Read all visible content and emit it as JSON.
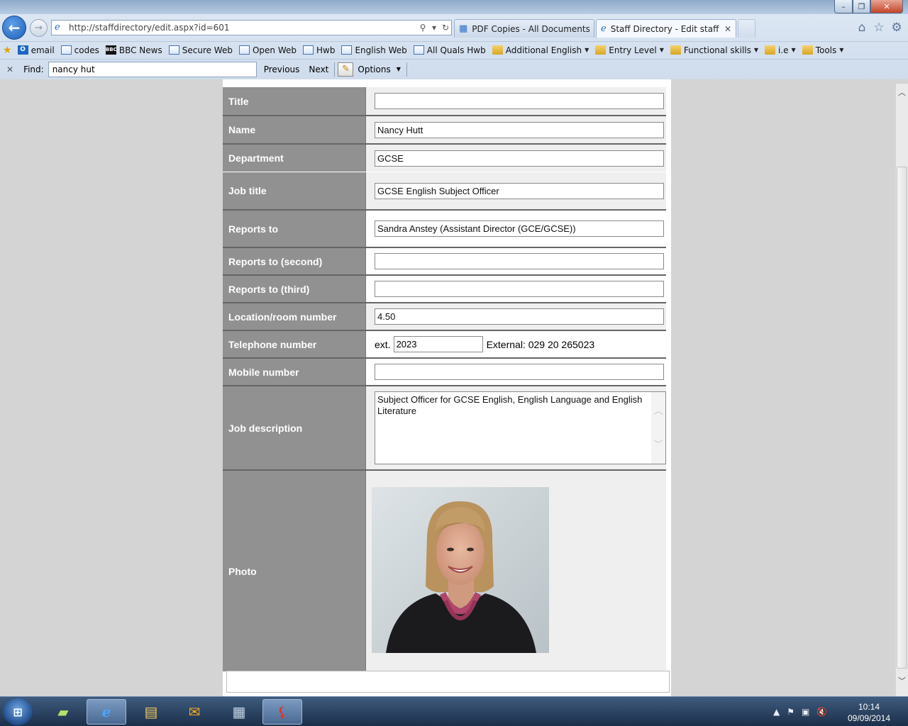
{
  "window": {
    "minimize_label": "–",
    "restore_label": "❐",
    "close_label": "✕"
  },
  "navigation": {
    "back_glyph": "←",
    "forward_glyph": "→",
    "address": "http://staffdirectory/edit.aspx?id=601"
  },
  "tabs": [
    {
      "label": "PDF Copies - All Documents",
      "icon": "sharepoint-page-icon"
    },
    {
      "label": "Staff Directory - Edit staff m...",
      "icon": "ie-page-icon",
      "close_label": "✕"
    }
  ],
  "favorites": {
    "items": [
      {
        "label": "email",
        "icon": "outlook-icon"
      },
      {
        "label": "codes",
        "icon": "web-page-icon"
      },
      {
        "label": "BBC News",
        "icon": "bbc-icon"
      },
      {
        "label": "Secure Web",
        "icon": "web-page-icon"
      },
      {
        "label": "Open Web",
        "icon": "web-page-icon"
      },
      {
        "label": "Hwb",
        "icon": "web-page-icon"
      },
      {
        "label": "English Web",
        "icon": "web-page-icon"
      },
      {
        "label": "All Quals Hwb",
        "icon": "web-page-icon"
      },
      {
        "label": "Additional English",
        "icon": "folder-icon"
      },
      {
        "label": "Entry Level",
        "icon": "folder-icon"
      },
      {
        "label": "Functional skills",
        "icon": "folder-icon"
      },
      {
        "label": "i.e",
        "icon": "folder-icon"
      },
      {
        "label": "Tools",
        "icon": "folder-icon"
      }
    ]
  },
  "find_bar": {
    "close_label": "✕",
    "label": "Find:",
    "value": "nancy hut",
    "previous_label": "Previous",
    "next_label": "Next",
    "options_label": "Options"
  },
  "form": {
    "title_label": "Title",
    "title_value": "",
    "name_label": "Name",
    "name_value": "Nancy Hutt",
    "department_label": "Department",
    "department_value": "GCSE",
    "job_title_label": "Job title",
    "job_title_value": "GCSE English Subject Officer",
    "reports_to_label": "Reports to",
    "reports_to_value": "Sandra Anstey (Assistant Director (GCE/GCSE))",
    "reports_to_second_label": "Reports to (second)",
    "reports_to_second_value": "",
    "reports_to_third_label": "Reports to (third)",
    "reports_to_third_value": "",
    "location_label": "Location/room number",
    "location_value": "4.50",
    "telephone_label": "Telephone number",
    "telephone_ext_prefix": "ext.",
    "telephone_ext_value": "2023",
    "telephone_external": "External: 029 20 265023",
    "mobile_label": "Mobile number",
    "mobile_value": "",
    "job_description_label": "Job description",
    "job_description_value": "Subject Officer for GCSE English, English Language and English Literature",
    "photo_label": "Photo"
  },
  "taskbar": {
    "apps": [
      "sticky-notes-icon",
      "internet-explorer-icon",
      "file-explorer-icon",
      "outlook-icon",
      "calculator-icon",
      "acrobat-icon"
    ],
    "time": "10:14",
    "date": "09/09/2014"
  },
  "colors": {
    "label_bg": "#919191",
    "value_bg": "#efefef",
    "page_bg": "#d4d4d4",
    "taskbar": "#1b2f49"
  }
}
